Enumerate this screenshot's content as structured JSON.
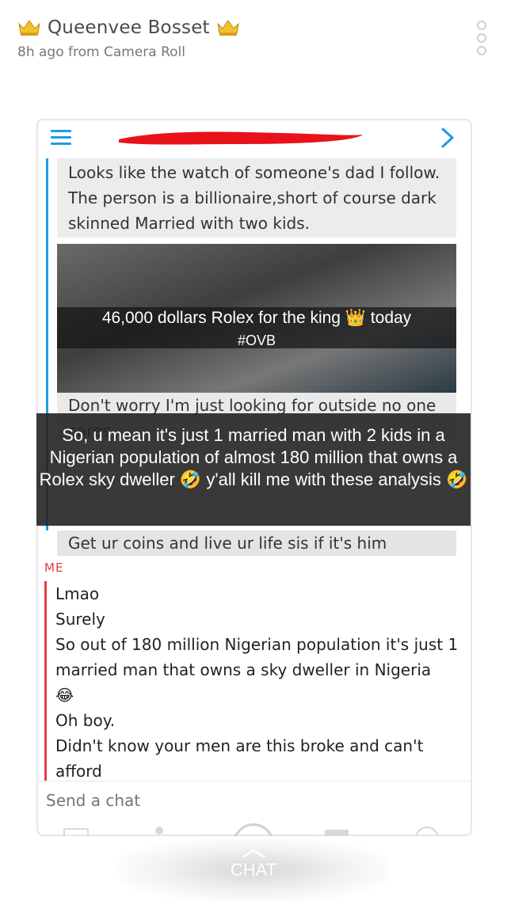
{
  "header": {
    "name": "Queenvee Bosset",
    "subtitle": "8h ago from Camera Roll"
  },
  "colors": {
    "accent_blue": "#1f9be6",
    "me_red": "#e63946",
    "redaction": "#e8121b"
  },
  "conversation": {
    "quoted_text_1": "Looks like the watch of someone's dad I follow. The person is a billionaire,short of course dark skinned Married with two kids.",
    "photo_caption_line1": "46,000 dollars Rolex for the king 👑 today",
    "photo_caption_line2": "#OVB",
    "quoted_text_2": "Don't worry I'm just looking for outside no one cares",
    "overlay_text": "So, u mean it's just 1 married man with 2 kids in a Nigerian population of almost 180 million that owns a Rolex sky dweller 🤣 y'all kill me with these analysis 🤣",
    "quoted_text_3": "Get ur coins and live ur life sis if it's him"
  },
  "me": {
    "label": "ME",
    "lines": [
      "Lmao",
      "Surely",
      "So out of 180 million Nigerian population it's just 1 married man that owns a sky dweller in Nigeria",
      "😂",
      "Oh boy.",
      "Didn't know your men are this broke and can't afford"
    ]
  },
  "composer": {
    "placeholder": "Send a chat"
  },
  "bottom_tab": {
    "label": "CHAT"
  }
}
